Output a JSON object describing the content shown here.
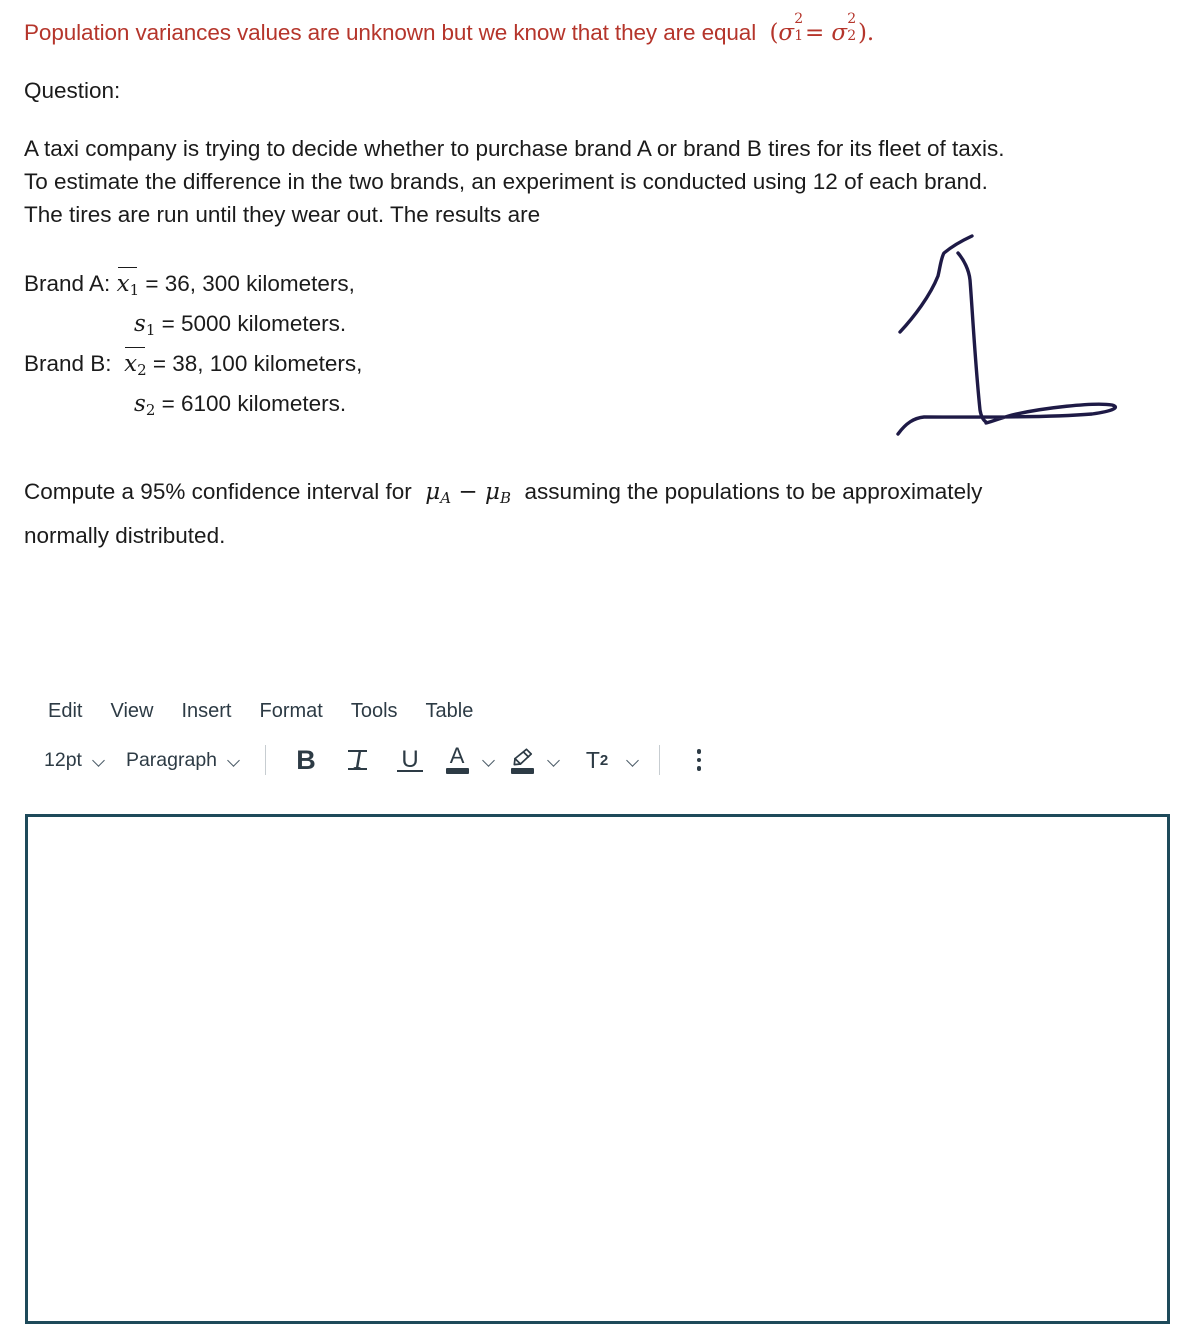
{
  "prompt": {
    "variance_note_prefix": "Population variances values are unknown but we know that they are equal",
    "variance_note_math": "(σ1² = σ2²).",
    "question_label": "Question:",
    "paragraph1_line1": "A taxi company is trying to decide whether to purchase brand A or brand B tires for its fleet of taxis.",
    "paragraph1_line2": "To estimate the difference in the two brands, an experiment is conducted using 12 of each brand.",
    "paragraph1_line3": "The tires are run until they wear out. The results are",
    "data": {
      "brand_a_label": "Brand A:",
      "brand_a_mean_symbol": "x̄1",
      "brand_a_mean_value": "= 36, 300 kilometers,",
      "brand_a_sd_symbol": "s1",
      "brand_a_sd_value": "= 5000 kilometers.",
      "brand_b_label": "Brand B:",
      "brand_b_mean_symbol": "x̄2",
      "brand_b_mean_value": "= 38, 100 kilometers,",
      "brand_b_sd_symbol": "s2",
      "brand_b_sd_value": "= 6100 kilometers."
    },
    "paragraph2_part1": "Compute a 95% confidence interval for",
    "paragraph2_math": "μA − μB",
    "paragraph2_part2": "assuming the populations to be approximately",
    "paragraph2_line2": "normally distributed."
  },
  "doodle": {
    "name": "handwritten-digit-one-annotation",
    "stroke_color": "#1e1a46"
  },
  "editor": {
    "menu": [
      {
        "label": "Edit"
      },
      {
        "label": "View"
      },
      {
        "label": "Insert"
      },
      {
        "label": "Format"
      },
      {
        "label": "Tools"
      },
      {
        "label": "Table"
      }
    ],
    "toolbar": {
      "font_size": "12pt",
      "block_format": "Paragraph",
      "bold_label": "B",
      "italic_label": "I",
      "underline_label": "U",
      "text_color_label": "A",
      "text_color_swatch": "#2d3b45",
      "highlight_swatch": "#2d3b45",
      "superscript_label": "T",
      "superscript_exponent": "2",
      "more_options_label": "more-options"
    },
    "answer_box": {
      "value": "",
      "placeholder": "",
      "border_color": "#1e4a5a"
    }
  },
  "colors": {
    "red_text": "#b5352b",
    "body_text": "#1b1b1b",
    "ui_text": "#2d3b45"
  }
}
